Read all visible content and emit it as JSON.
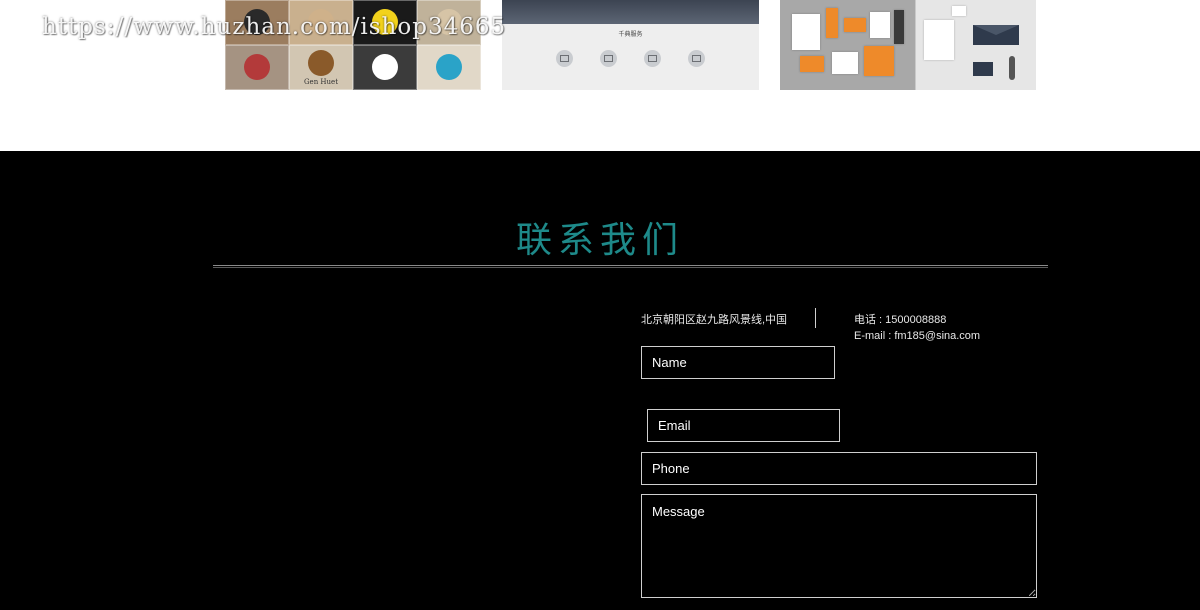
{
  "watermark": "https://www.huzhan.com/ishop34665",
  "portfolio": {
    "logos": [
      {
        "name": "",
        "color": "#2a2a2a",
        "tile": "#9b7d5f"
      },
      {
        "name": "",
        "color": "#cfb18a",
        "tile": "#c9b08e"
      },
      {
        "name": "",
        "color": "#f2d21c",
        "tile": "#1a1a1a"
      },
      {
        "name": "",
        "color": "#d6c4a6",
        "tile": "#c0b29a"
      },
      {
        "name": "",
        "color": "#b33a3a",
        "tile": "#a59382"
      },
      {
        "name": "Gen Huet",
        "color": "#8a5a2a",
        "tile": "#d2c6b2"
      },
      {
        "name": "",
        "color": "#ffffff",
        "tile": "#3b3b3b"
      },
      {
        "name": "",
        "color": "#2aa3c8",
        "tile": "#e1d8c8"
      }
    ],
    "web": {
      "heading": "千典服务",
      "subheading": "",
      "icons": [
        "monitor-icon",
        "laptop-icon",
        "phone-icon",
        "window-icon"
      ]
    }
  },
  "contact": {
    "title": "联系我们",
    "address": "北京朝阳区赵九路风景线,中国",
    "phone": "电话 : 1500008888",
    "email": "E-mail : fm185@sina.com",
    "form": {
      "name_placeholder": "Name",
      "email_placeholder": "Email",
      "phone_placeholder": "Phone",
      "message_placeholder": "Message"
    }
  },
  "colors": {
    "title": "#1e8a8a",
    "background": "#000000",
    "accent_orange": "#ee8a2a"
  }
}
